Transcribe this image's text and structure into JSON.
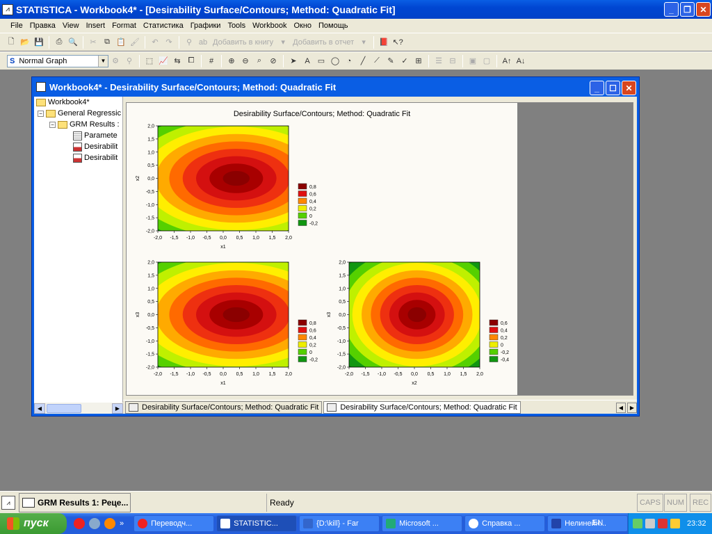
{
  "app": {
    "title": "STATISTICA - Workbook4* - [Desirability Surface/Contours; Method: Quadratic Fit]",
    "icon": "chart-app-icon"
  },
  "menu": [
    "File",
    "Правка",
    "View",
    "Insert",
    "Format",
    "Статистика",
    "Графики",
    "Tools",
    "Workbook",
    "Окно",
    "Помощь"
  ],
  "toolbar1": {
    "add_to_book": "Добавить в книгу",
    "add_to_report": "Добавить в отчет"
  },
  "toolbar2": {
    "graph_style": "Normal Graph"
  },
  "workbook": {
    "title": "Workbook4* - Desirability Surface/Contours; Method: Quadratic Fit",
    "tree": [
      {
        "label": "Workbook4*"
      },
      {
        "label": "General Regressic"
      },
      {
        "label": "GRM Results :"
      },
      {
        "label": "Paramete"
      },
      {
        "label": "Desirabilit"
      },
      {
        "label": "Desirabilit"
      }
    ],
    "tabs": [
      "Desirability Surface/Contours; Method: Quadratic Fit",
      "Desirability Surface/Contours; Method: Quadratic Fit"
    ]
  },
  "chart_data": [
    {
      "type": "heatmap",
      "title": "Desirability Surface/Contours; Method: Quadratic Fit",
      "xlabel": "x1",
      "ylabel": "x2",
      "xlim": [
        -2.0,
        2.0
      ],
      "ylim": [
        -2.0,
        2.0
      ],
      "x_ticks": [
        "-2,0",
        "-1,5",
        "-1,0",
        "-0,5",
        "0,0",
        "0,5",
        "1,0",
        "1,5",
        "2,0"
      ],
      "y_ticks": [
        "2,0",
        "1,5",
        "1,0",
        "0,5",
        "0,0",
        "-0,5",
        "-1,0",
        "-1,5",
        "-2,0"
      ],
      "legend": [
        "0,8",
        "0,6",
        "0,4",
        "0,2",
        "0",
        "-0,2"
      ],
      "legend_colors": [
        "#8b0000",
        "#e01010",
        "#ff8800",
        "#eeee00",
        "#55d000",
        "#119611"
      ]
    },
    {
      "type": "heatmap",
      "xlabel": "x1",
      "ylabel": "x3",
      "xlim": [
        -2.0,
        2.0
      ],
      "ylim": [
        -2.0,
        2.0
      ],
      "x_ticks": [
        "-2,0",
        "-1,5",
        "-1,0",
        "-0,5",
        "0,0",
        "0,5",
        "1,0",
        "1,5",
        "2,0"
      ],
      "y_ticks": [
        "2,0",
        "1,5",
        "1,0",
        "0,5",
        "0,0",
        "-0,5",
        "-1,0",
        "-1,5",
        "-2,0"
      ],
      "legend": [
        "0,8",
        "0,6",
        "0,4",
        "0,2",
        "0",
        "-0,2"
      ],
      "legend_colors": [
        "#8b0000",
        "#e01010",
        "#ff8800",
        "#eeee00",
        "#55d000",
        "#119611"
      ]
    },
    {
      "type": "heatmap",
      "xlabel": "x2",
      "ylabel": "x3",
      "xlim": [
        -2.0,
        2.0
      ],
      "ylim": [
        -2.0,
        2.0
      ],
      "x_ticks": [
        "-2,0",
        "-1,5",
        "-1,0",
        "-0,5",
        "0,0",
        "0,5",
        "1,0",
        "1,5",
        "2,0"
      ],
      "y_ticks": [
        "2,0",
        "1,5",
        "1,0",
        "0,5",
        "0,0",
        "-0,5",
        "-1,0",
        "-1,5",
        "-2,0"
      ],
      "legend": [
        "0,6",
        "0,4",
        "0,2",
        "0",
        "-0,2",
        "-0,4"
      ],
      "legend_colors": [
        "#8b0000",
        "#e01010",
        "#ff8800",
        "#eeee00",
        "#55d000",
        "#119611"
      ]
    }
  ],
  "statusbar": {
    "task": "GRM Results 1: Реце...",
    "ready": "Ready",
    "caps": "CAPS",
    "num": "NUM",
    "rec": "REC"
  },
  "taskbar": {
    "start": "пуск",
    "items": [
      "Переводч...",
      "STATISTIC...",
      "{D:\\kill} - Far",
      "Microsoft ...",
      "Справка ...",
      "Нелинейн..."
    ],
    "lang": "EN",
    "time": "23:32"
  }
}
